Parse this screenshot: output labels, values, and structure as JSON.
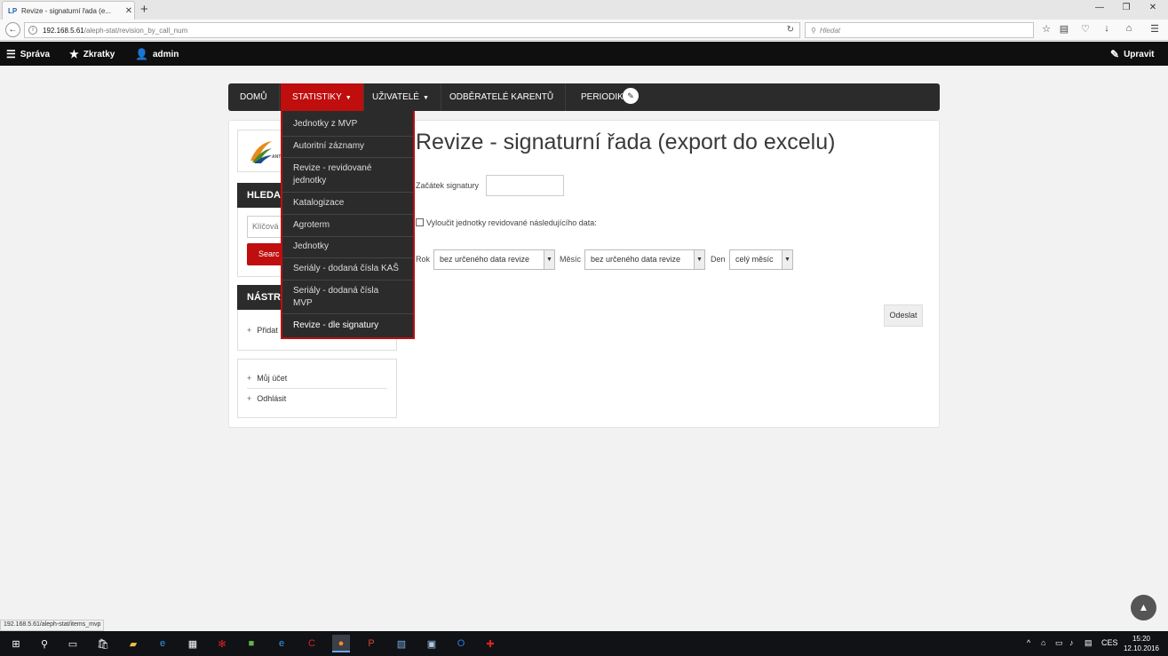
{
  "browser": {
    "tab_title": "Revize - signaturní řada (e...",
    "new_tab": "+",
    "url_host": "192.168.5.61",
    "url_path": "/aleph-stat/revision_by_call_num",
    "search_placeholder": "Hledat"
  },
  "admin_bar": {
    "menu_label": "Správa",
    "shortcuts_label": "Zkratky",
    "user_label": "admin",
    "edit_label": "Upravit"
  },
  "nav": {
    "items": [
      {
        "label": "DOMŮ"
      },
      {
        "label": "STATISTIKY",
        "active": true
      },
      {
        "label": "UŽIVATELÉ"
      },
      {
        "label": "ODBĚRATELÉ KARENTŮ"
      },
      {
        "label": "PERIODIK"
      }
    ]
  },
  "dropdown": {
    "items": [
      "Jednotky z MVP",
      "Autoritní záznamy",
      "Revize - revidované jednotky",
      "Katalogizace",
      "Agroterm",
      "Jednotky",
      "Seriály - dodaná čísla KAŠ",
      "Seriály - dodaná čísla MVP",
      "Revize - dle signatury"
    ]
  },
  "sidebar": {
    "logo_text": "ANT",
    "search_heading": "HLEDA",
    "search_placeholder": "Klíčová",
    "search_button": "Searc",
    "tools_heading": "NÁSTR",
    "tools_link": "Přidat",
    "account_links": [
      "Můj účet",
      "Odhlásit"
    ]
  },
  "form": {
    "title": "Revize - signaturní řada (export do excelu)",
    "start_label": "Začátek signatury",
    "exclude_label": "Vyloučit jednotky revidované následujícího data:",
    "year_label": "Rok",
    "year_value": "bez určeného data revize",
    "month_label": "Měsíc",
    "month_value": "bez určeného data revize",
    "day_label": "Den",
    "day_value": "celý měsíc",
    "submit": "Odeslat"
  },
  "status_url": "192.168.5.61/aleph-stat/items_mvp",
  "taskbar": {
    "lang": "CES",
    "time": "15:20",
    "date": "12.10.2016"
  },
  "colors": {
    "accent_red": "#c00e0e",
    "nav_dark": "#2b2b2b",
    "admin_black": "#0f0f0f"
  }
}
